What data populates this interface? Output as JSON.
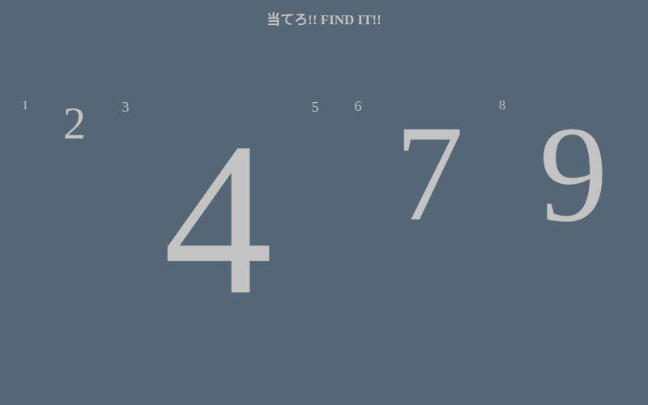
{
  "title": "当てろ!! FIND IT!!",
  "colors": {
    "background": "#556677",
    "number": "#c3c3c3"
  },
  "numbers": [
    {
      "id": "1",
      "label": "1"
    },
    {
      "id": "2",
      "label": "2"
    },
    {
      "id": "3",
      "label": "3"
    },
    {
      "id": "4",
      "label": "4"
    },
    {
      "id": "5",
      "label": "5"
    },
    {
      "id": "6",
      "label": "6"
    },
    {
      "id": "7",
      "label": "7"
    },
    {
      "id": "8",
      "label": "8"
    },
    {
      "id": "9",
      "label": "9"
    }
  ]
}
